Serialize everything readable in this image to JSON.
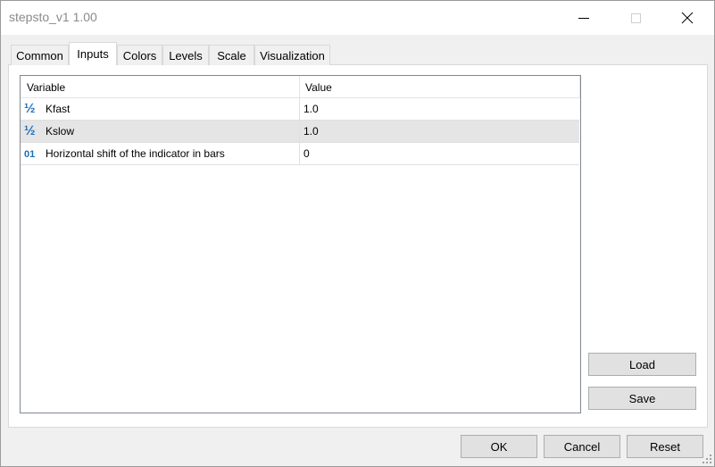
{
  "window": {
    "title": "stepsto_v1 1.00"
  },
  "tabs": [
    {
      "label": "Common"
    },
    {
      "label": "Inputs"
    },
    {
      "label": "Colors"
    },
    {
      "label": "Levels"
    },
    {
      "label": "Scale"
    },
    {
      "label": "Visualization"
    }
  ],
  "active_tab": "Inputs",
  "grid": {
    "columns": [
      "Variable",
      "Value"
    ],
    "rows": [
      {
        "icon": "half-fraction-icon",
        "glyph": "½",
        "variable": "Kfast",
        "value": "1.0"
      },
      {
        "icon": "half-fraction-icon",
        "glyph": "½",
        "variable": "Kslow",
        "value": "1.0"
      },
      {
        "icon": "integer-icon",
        "glyph": "01",
        "variable": "Horizontal shift of the indicator in bars",
        "value": "0"
      }
    ]
  },
  "side_buttons": {
    "load": "Load",
    "save": "Save"
  },
  "footer_buttons": {
    "ok": "OK",
    "cancel": "Cancel",
    "reset": "Reset"
  },
  "colors": {
    "accent": "#1e6fb8",
    "selected_row": "#e5e5e5"
  }
}
